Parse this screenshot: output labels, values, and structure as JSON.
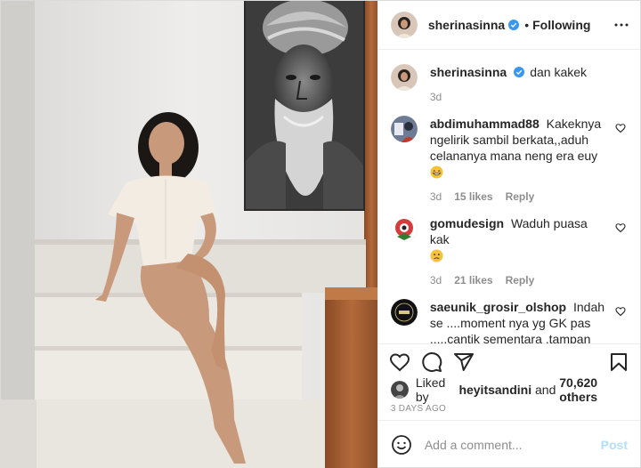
{
  "post": {
    "author": "sherinasinna",
    "follow_label": "Following",
    "dot": "•",
    "verified": true
  },
  "caption": {
    "user": "sherinasinna",
    "text": "dan kakek",
    "age": "3d"
  },
  "comments": [
    {
      "user": "abdimuhammad88",
      "text": "Kakeknya ngelirik sambil berkata,,aduh celananya mana neng era euy",
      "emoji": "grin",
      "age": "3d",
      "likes": "15 likes",
      "reply": "Reply"
    },
    {
      "user": "gomudesign",
      "text": "Waduh puasa kak",
      "emoji": "sad",
      "age": "3d",
      "likes": "21 likes",
      "reply": "Reply"
    },
    {
      "user": "saeunik_grosir_olshop",
      "text": "Indah se ....moment nya yg GK pas .....cantik sementara ,tampan sementara dunia semntara akhirat selama lamanya...smoga",
      "age": "",
      "likes": "",
      "reply": ""
    }
  ],
  "likes": {
    "prefix": "Liked by",
    "user": "heyitsandini",
    "and": "and",
    "count": "70,620 others"
  },
  "timestamp": "3 DAYS AGO",
  "add_comment": {
    "placeholder": "Add a comment...",
    "post_label": "Post"
  },
  "icons": {
    "more": "more-horizontal-icon",
    "like": "heart-icon",
    "comment": "comment-bubble-icon",
    "share": "paper-plane-icon",
    "save": "bookmark-icon",
    "emoji": "smile-icon",
    "verified": "verified-badge-icon"
  },
  "colors": {
    "verified": "#3897f0",
    "text": "#262626",
    "muted": "#8e8e8e",
    "post_disabled": "#b2dffc",
    "border": "#dbdbdb"
  }
}
